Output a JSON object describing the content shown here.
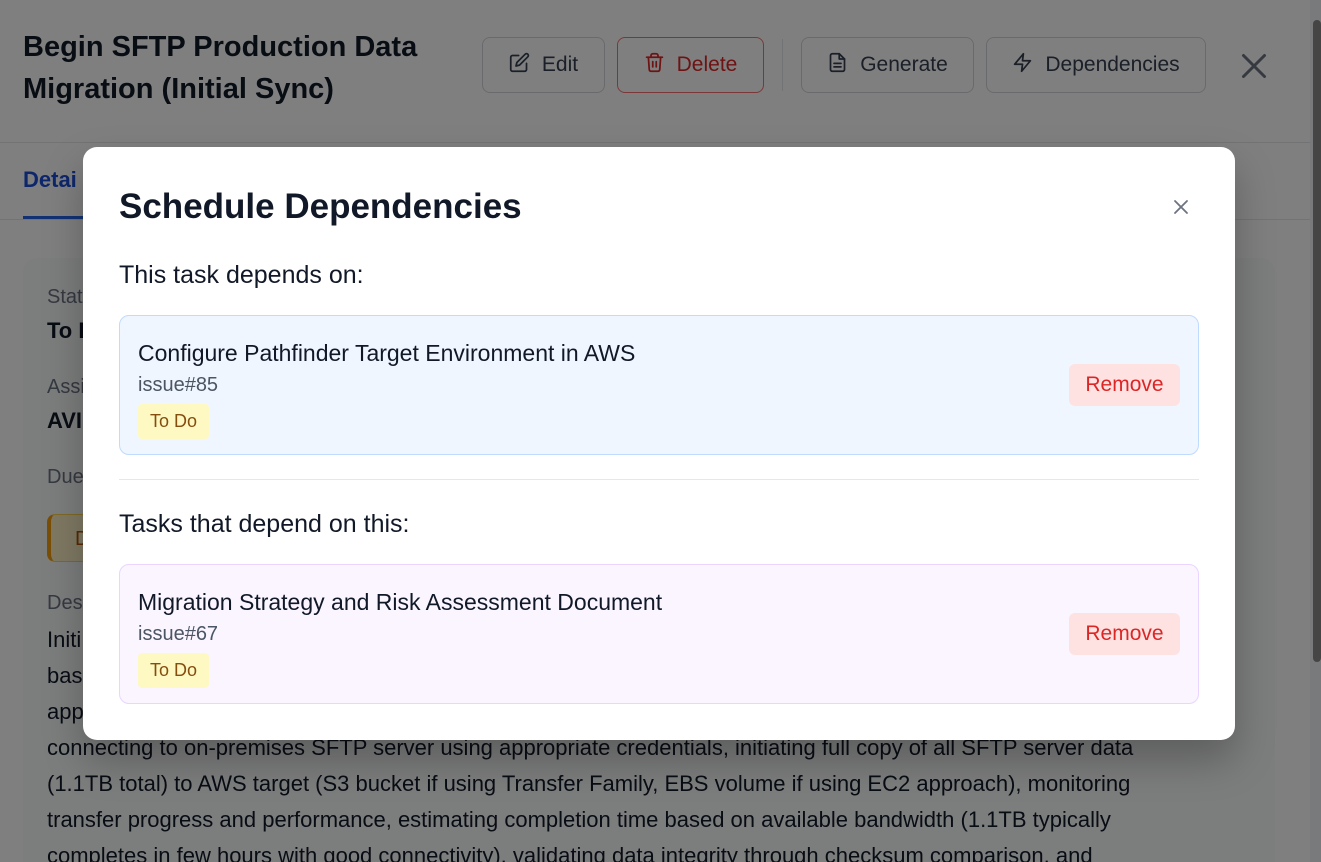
{
  "task": {
    "title": "Begin SFTP Production Data Migration (Initial Sync)",
    "actions": {
      "edit": "Edit",
      "delete": "Delete",
      "generate": "Generate",
      "dependencies": "Dependencies"
    }
  },
  "tabs": {
    "active": "Detai"
  },
  "details": {
    "status_label": "Stat",
    "status_value": "To I",
    "assignee_label": "Assi",
    "assignee_value": "AVI",
    "due_label": "Due",
    "due_badge": "D",
    "description_label": "Des",
    "description_lines": [
      "Initi",
      "bas",
      "app",
      "connecting to on-premises SFTP server using appropriate credentials, initiating full copy of all SFTP server data",
      "(1.1TB total) to AWS target (S3 bucket if using Transfer Family, EBS volume if using EC2 approach), monitoring",
      "transfer progress and performance, estimating completion time based on available bandwidth (1.1TB typically",
      "completes in few hours with good connectivity), validating data integrity through checksum comparison, and"
    ]
  },
  "modal": {
    "title": "Schedule Dependencies",
    "depends_on_heading": "This task depends on:",
    "dependents_heading": "Tasks that depend on this:",
    "depends_on": [
      {
        "name": "Configure Pathfinder Target Environment in AWS",
        "id": "issue#85",
        "status": "To Do",
        "action": "Remove"
      }
    ],
    "dependents": [
      {
        "name": "Migration Strategy and Risk Assessment Document",
        "id": "issue#67",
        "status": "To Do",
        "action": "Remove"
      }
    ]
  },
  "colors": {
    "accent": "#2563eb",
    "danger": "#dc2626",
    "upstream_card_bg": "#eff6ff",
    "downstream_card_bg": "#faf5ff",
    "status_todo_bg": "#fef9c3"
  },
  "icons": {
    "edit": "pencil-square-icon",
    "delete": "trash-icon",
    "generate": "document-icon",
    "dependencies": "lightning-bolt-icon",
    "close": "close-icon"
  }
}
